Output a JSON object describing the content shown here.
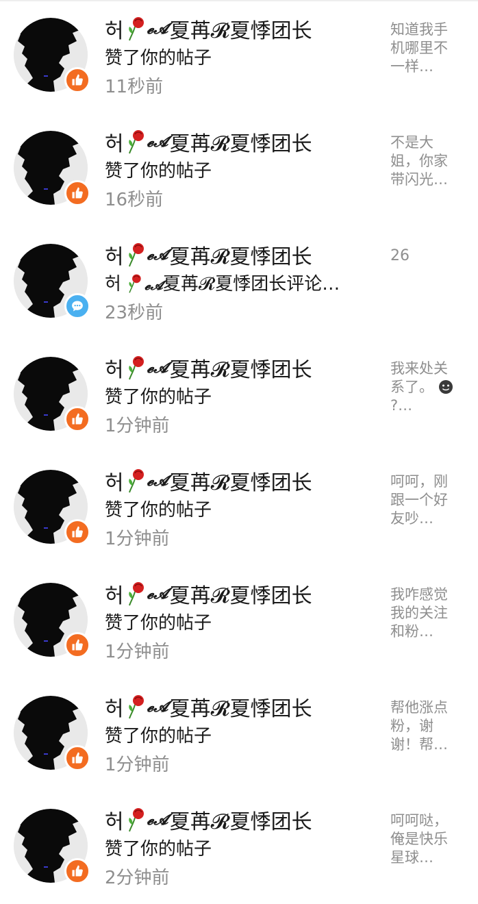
{
  "notifications": [
    {
      "user": {
        "prefix": "허",
        "script": "𝓮𝓐",
        "name": "夏苒𝓡夏悸团长"
      },
      "type": "like",
      "badge_icon": "thumbs-up-icon",
      "action": "赞了你的帖子",
      "time": "11秒前",
      "preview": "知道我手机哪里不一样…"
    },
    {
      "user": {
        "prefix": "허",
        "script": "𝓮𝓐",
        "name": "夏苒𝓡夏悸团长"
      },
      "type": "like",
      "badge_icon": "thumbs-up-icon",
      "action": "赞了你的帖子",
      "time": "16秒前",
      "preview": "不是大姐，你家带闪光…"
    },
    {
      "user": {
        "prefix": "허",
        "script": "𝓮𝓐",
        "name": "夏苒𝓡夏悸团长"
      },
      "type": "comment",
      "badge_icon": "comment-bubble-icon",
      "action_prefix": "허",
      "action_script": "𝓮𝓐",
      "action": "夏苒𝓡夏悸团长评论…",
      "time": "23秒前",
      "preview": "26"
    },
    {
      "user": {
        "prefix": "허",
        "script": "𝓮𝓐",
        "name": "夏苒𝓡夏悸团长"
      },
      "type": "like",
      "badge_icon": "thumbs-up-icon",
      "action": "赞了你的帖子",
      "time": "1分钟前",
      "preview": "我来处关系了。",
      "preview_suffix": "?…"
    },
    {
      "user": {
        "prefix": "허",
        "script": "𝓮𝓐",
        "name": "夏苒𝓡夏悸团长"
      },
      "type": "like",
      "badge_icon": "thumbs-up-icon",
      "action": "赞了你的帖子",
      "time": "1分钟前",
      "preview": "呵呵，刚跟一个好友吵…"
    },
    {
      "user": {
        "prefix": "허",
        "script": "𝓮𝓐",
        "name": "夏苒𝓡夏悸团长"
      },
      "type": "like",
      "badge_icon": "thumbs-up-icon",
      "action": "赞了你的帖子",
      "time": "1分钟前",
      "preview": "我咋感觉我的关注和粉…"
    },
    {
      "user": {
        "prefix": "허",
        "script": "𝓮𝓐",
        "name": "夏苒𝓡夏悸团长"
      },
      "type": "like",
      "badge_icon": "thumbs-up-icon",
      "action": "赞了你的帖子",
      "time": "1分钟前",
      "preview": "帮他涨点粉，谢谢！帮…"
    },
    {
      "user": {
        "prefix": "허",
        "script": "𝓮𝓐",
        "name": "夏苒𝓡夏悸团长"
      },
      "type": "like",
      "badge_icon": "thumbs-up-icon",
      "action": "赞了你的帖子",
      "time": "2分钟前",
      "preview": "呵呵哒，俺是快乐星球…"
    }
  ],
  "colors": {
    "like_badge": "#f36c21",
    "comment_badge": "#4ab0f0",
    "text_primary": "#1a1a1a",
    "text_secondary": "#8e8e8e"
  }
}
